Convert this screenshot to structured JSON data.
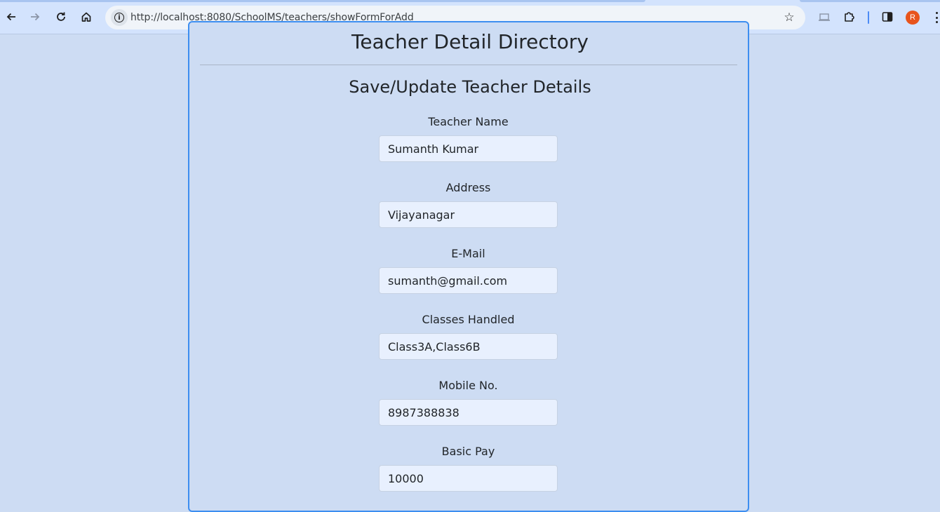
{
  "browser": {
    "url": "http://localhost:8080/SchoolMS/teachers/showFormForAdd",
    "profile_initial": "R"
  },
  "page": {
    "title": "Teacher Detail Directory",
    "form_title": "Save/Update Teacher Details"
  },
  "form": {
    "name": {
      "label": "Teacher Name",
      "value": "Sumanth Kumar"
    },
    "address": {
      "label": "Address",
      "value": "Vijayanagar"
    },
    "email": {
      "label": "E-Mail",
      "value": "sumanth@gmail.com"
    },
    "classes": {
      "label": "Classes Handled",
      "value": "Class3A,Class6B"
    },
    "mobile": {
      "label": "Mobile No.",
      "value": "8987388838"
    },
    "basic_pay": {
      "label": "Basic Pay",
      "value": "10000"
    }
  }
}
